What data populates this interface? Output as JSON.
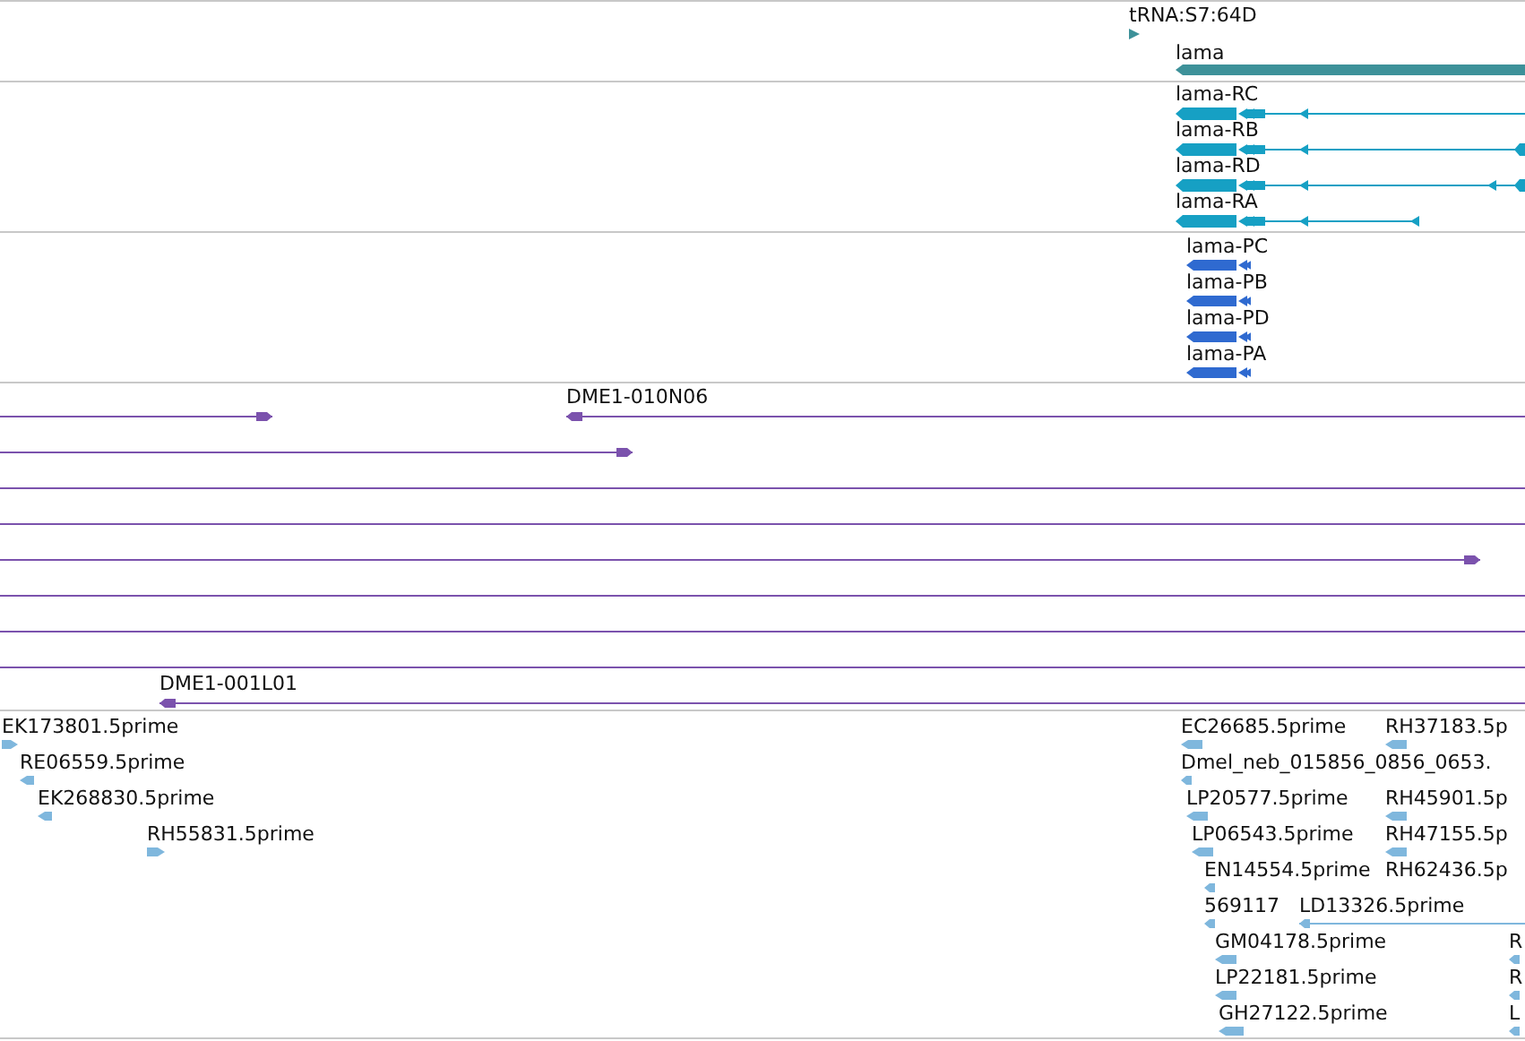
{
  "tracks": [
    {
      "kind": "genes",
      "features": [
        {
          "kind": "trna",
          "label": "tRNA:S7:64D",
          "reverse": false
        },
        {
          "kind": "gene",
          "label": "lama",
          "reverse": true
        }
      ]
    },
    {
      "kind": "transcripts",
      "features": [
        {
          "label": "lama-RC",
          "reverse": true
        },
        {
          "label": "lama-RB",
          "reverse": true
        },
        {
          "label": "lama-RD",
          "reverse": true
        },
        {
          "label": "lama-RA",
          "reverse": true
        }
      ]
    },
    {
      "kind": "proteins",
      "features": [
        {
          "label": "lama-PC",
          "reverse": true
        },
        {
          "label": "lama-PB",
          "reverse": true
        },
        {
          "label": "lama-PD",
          "reverse": true
        },
        {
          "label": "lama-PA",
          "reverse": true
        }
      ]
    },
    {
      "kind": "clones",
      "features": [
        {
          "head_shown": true,
          "reverse": false
        },
        {
          "label": "DME1-010N06",
          "head_shown": true,
          "reverse": true
        },
        {
          "head_shown": true,
          "reverse": false
        },
        {
          "head_shown": false
        },
        {
          "head_shown": false
        },
        {
          "head_shown": true,
          "reverse": false
        },
        {
          "head_shown": false
        },
        {
          "head_shown": false
        },
        {
          "head_shown": false
        },
        {
          "label": "DME1-001L01",
          "head_shown": true,
          "reverse": true
        }
      ]
    },
    {
      "kind": "ests",
      "features": [
        {
          "label": "EK173801.5prime",
          "reverse": false
        },
        {
          "label": "EC26685.5prime",
          "reverse": true
        },
        {
          "label": "RH37183.5p",
          "reverse": true
        },
        {
          "label": "RE06559.5prime",
          "reverse": true
        },
        {
          "label": "Dmel_neb_015856_0856_0653.",
          "reverse": true
        },
        {
          "label": "EK268830.5prime",
          "reverse": true
        },
        {
          "label": "LP20577.5prime",
          "reverse": true
        },
        {
          "label": "RH45901.5p",
          "reverse": true
        },
        {
          "label": "RH55831.5prime",
          "reverse": false
        },
        {
          "label": "LP06543.5prime",
          "reverse": true
        },
        {
          "label": "RH47155.5p",
          "reverse": true
        },
        {
          "label": "EN14554.5prime",
          "reverse": true
        },
        {
          "label": "RH62436.5p"
        },
        {
          "label": "569117",
          "reverse": true
        },
        {
          "label": "LD13326.5prime",
          "reverse": true
        },
        {
          "label": "GM04178.5prime",
          "reverse": true
        },
        {
          "label": "R",
          "reverse": true
        },
        {
          "label": "LP22181.5prime",
          "reverse": true
        },
        {
          "label": "R",
          "reverse": true
        },
        {
          "label": "GH27122.5prime",
          "reverse": true
        },
        {
          "label": "L",
          "reverse": true
        }
      ]
    }
  ]
}
